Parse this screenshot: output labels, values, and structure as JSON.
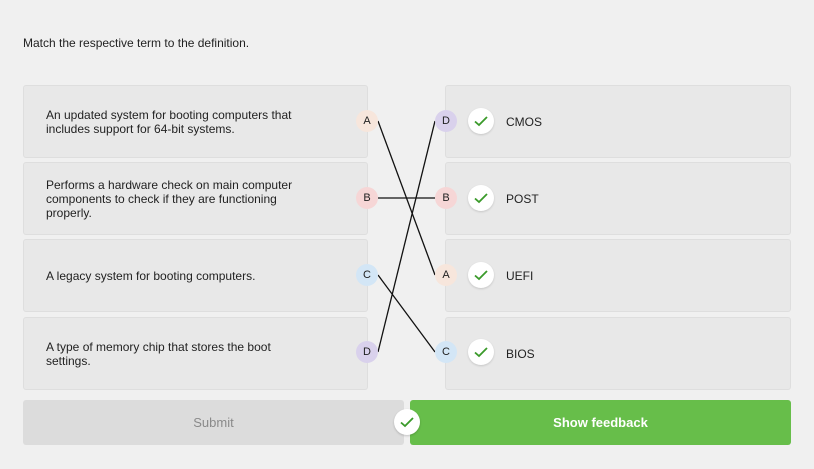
{
  "instruction": "Match the respective term to the definition.",
  "left_items": [
    {
      "text": "An updated system for booting computers that includes support for 64-bit systems.",
      "label": "A"
    },
    {
      "text": "Performs a hardware check on main computer components to check if they are functioning properly.",
      "label": "B"
    },
    {
      "text": "A legacy system for booting computers.",
      "label": "C"
    },
    {
      "text": "A type of memory chip that stores the boot settings.",
      "label": "D"
    }
  ],
  "right_items": [
    {
      "label": "D",
      "term": "CMOS",
      "status": "correct"
    },
    {
      "label": "B",
      "term": "POST",
      "status": "correct"
    },
    {
      "label": "A",
      "term": "UEFI",
      "status": "correct"
    },
    {
      "label": "C",
      "term": "BIOS",
      "status": "correct"
    }
  ],
  "buttons": {
    "submit": "Submit",
    "show_feedback": "Show feedback"
  },
  "colors": {
    "accent_green": "#67be4a",
    "check_green": "#3a9a2a",
    "label_A": "#f7e6dc",
    "label_B": "#f6d6d6",
    "label_C": "#d3e6f6",
    "label_D": "#d9d1ec"
  }
}
